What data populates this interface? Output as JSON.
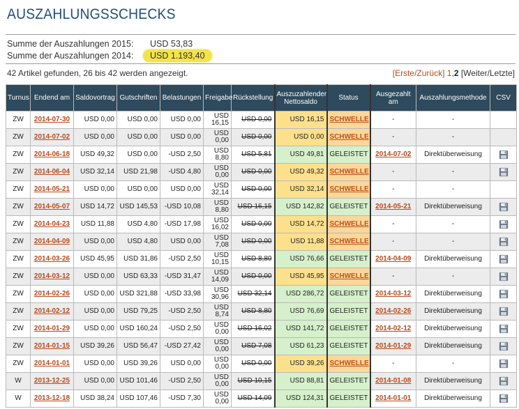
{
  "page": {
    "title": "AUSZAHLUNGSSCHECKS",
    "sums": [
      {
        "label": "Summe der Auszahlungen 2015:",
        "value": "USD 53,83",
        "highlight": false
      },
      {
        "label": "Summe der Auszahlungen 2014:",
        "value": "USD 1.193,40",
        "highlight": true
      }
    ],
    "found_text": "42 Artikel gefunden, 26 bis 42 werden angezeigt.",
    "pager": {
      "first_prev": "[Erste/Zurück]",
      "page1": "1",
      "sep": ",",
      "page2": "2",
      "next_last": "[Weiter/Letzte]"
    }
  },
  "table": {
    "headers": [
      "Turnus",
      "Endend am",
      "Saldovortrag",
      "Gutschriften",
      "Belastungen",
      "Freigabe",
      "Rückstellung",
      "Auszuzahlender Nettosaldo",
      "Status",
      "Ausgezahlt am",
      "Auszahlungsmethode",
      "CSV"
    ],
    "rows": [
      {
        "turnus": "ZW",
        "end": "2014-07-30",
        "saldo": "USD 0,00",
        "gut": "USD 0,00",
        "bel": "USD 0,00",
        "frei": [
          "USD",
          "16,15"
        ],
        "rueck": "USD 0,00",
        "netto": "USD 16,15",
        "status": "SCHWELLE",
        "paid": "-",
        "method": "-",
        "csv": false
      },
      {
        "turnus": "ZW",
        "end": "2014-07-02",
        "saldo": "USD 0,00",
        "gut": "USD 0,00",
        "bel": "USD 0,00",
        "frei": [
          "USD",
          "0,00"
        ],
        "rueck": "USD 0,00",
        "netto": "USD 0,00",
        "status": "SCHWELLE",
        "paid": "-",
        "method": "-",
        "csv": false
      },
      {
        "turnus": "ZW",
        "end": "2014-06-18",
        "saldo": "USD 49,32",
        "gut": "USD 0,00",
        "bel": "-USD 2,50",
        "frei": [
          "USD",
          "8,80"
        ],
        "rueck": "USD 5,81",
        "netto": "USD 49,81",
        "status": "GELEISTET",
        "paid": "2014-07-02",
        "method": "Direktüberweisung",
        "csv": true
      },
      {
        "turnus": "ZW",
        "end": "2014-06-04",
        "saldo": "USD 32,14",
        "gut": "USD 21,98",
        "bel": "-USD 4,80",
        "frei": [
          "USD",
          "0,00"
        ],
        "rueck": "USD 0,00",
        "netto": "USD 49,32",
        "status": "SCHWELLE",
        "paid": "-",
        "method": "-",
        "csv": true
      },
      {
        "turnus": "ZW",
        "end": "2014-05-21",
        "saldo": "USD 0,00",
        "gut": "USD 0,00",
        "bel": "USD 0,00",
        "frei": [
          "USD",
          "32,14"
        ],
        "rueck": "USD 0,00",
        "netto": "USD 32,14",
        "status": "SCHWELLE",
        "paid": "-",
        "method": "-",
        "csv": false
      },
      {
        "turnus": "ZW",
        "end": "2014-05-07",
        "saldo": "USD 14,72",
        "gut": "USD 145,53",
        "bel": "-USD 10,08",
        "frei": [
          "USD",
          "8,80"
        ],
        "rueck": "USD 16,15",
        "netto": "USD 142,82",
        "status": "GELEISTET",
        "paid": "2014-05-21",
        "method": "Direktüberweisung",
        "csv": true
      },
      {
        "turnus": "ZW",
        "end": "2014-04-23",
        "saldo": "USD 11,88",
        "gut": "USD 4,80",
        "bel": "-USD 17,98",
        "frei": [
          "USD",
          "16,02"
        ],
        "rueck": "USD 0,00",
        "netto": "USD 14,72",
        "status": "SCHWELLE",
        "paid": "-",
        "method": "-",
        "csv": true
      },
      {
        "turnus": "ZW",
        "end": "2014-04-09",
        "saldo": "USD 0,00",
        "gut": "USD 4,80",
        "bel": "USD 0,00",
        "frei": [
          "USD",
          "7,08"
        ],
        "rueck": "USD 0,00",
        "netto": "USD 11,88",
        "status": "SCHWELLE",
        "paid": "-",
        "method": "-",
        "csv": true
      },
      {
        "turnus": "ZW",
        "end": "2014-03-26",
        "saldo": "USD 45,95",
        "gut": "USD 31,86",
        "bel": "-USD 2,50",
        "frei": [
          "USD",
          "10,15"
        ],
        "rueck": "USD 8,80",
        "netto": "USD 76,66",
        "status": "GELEISTET",
        "paid": "2014-04-09",
        "method": "Direktüberweisung",
        "csv": true
      },
      {
        "turnus": "ZW",
        "end": "2014-03-12",
        "saldo": "USD 0,00",
        "gut": "USD 63,33",
        "bel": "-USD 31,47",
        "frei": [
          "USD",
          "14,09"
        ],
        "rueck": "USD 0,00",
        "netto": "USD 45,95",
        "status": "SCHWELLE",
        "paid": "-",
        "method": "-",
        "csv": true
      },
      {
        "turnus": "ZW",
        "end": "2014-02-26",
        "saldo": "USD 0,00",
        "gut": "USD 321,88",
        "bel": "-USD 33,98",
        "frei": [
          "USD",
          "30,96"
        ],
        "rueck": "USD 32,14",
        "netto": "USD 286,72",
        "status": "GELEISTET",
        "paid": "2014-03-12",
        "method": "Direktüberweisung",
        "csv": true
      },
      {
        "turnus": "ZW",
        "end": "2014-02-12",
        "saldo": "USD 0,00",
        "gut": "USD 79,25",
        "bel": "-USD 2,50",
        "frei": [
          "USD",
          "8,74"
        ],
        "rueck": "USD 8,80",
        "netto": "USD 76,69",
        "status": "GELEISTET",
        "paid": "2014-02-26",
        "method": "Direktüberweisung",
        "csv": true
      },
      {
        "turnus": "ZW",
        "end": "2014-01-29",
        "saldo": "USD 0,00",
        "gut": "USD 160,24",
        "bel": "-USD 2,50",
        "frei": [
          "USD",
          "0,00"
        ],
        "rueck": "USD 16,02",
        "netto": "USD 141,72",
        "status": "GELEISTET",
        "paid": "2014-02-12",
        "method": "Direktüberweisung",
        "csv": true
      },
      {
        "turnus": "ZW",
        "end": "2014-01-15",
        "saldo": "USD 39,26",
        "gut": "USD 56,47",
        "bel": "-USD 27,42",
        "frei": [
          "USD",
          "0,00"
        ],
        "rueck": "USD 7,08",
        "netto": "USD 61,23",
        "status": "GELEISTET",
        "paid": "2014-01-29",
        "method": "Direktüberweisung",
        "csv": true
      },
      {
        "turnus": "ZW",
        "end": "2014-01-01",
        "saldo": "USD 0,00",
        "gut": "USD 39,26",
        "bel": "USD 0,00",
        "frei": [
          "USD",
          "0,00"
        ],
        "rueck": "USD 0,00",
        "netto": "USD 39,26",
        "status": "SCHWELLE",
        "paid": "-",
        "method": "-",
        "csv": true
      },
      {
        "turnus": "W",
        "end": "2013-12-25",
        "saldo": "USD 0,00",
        "gut": "USD 101,46",
        "bel": "-USD 2,50",
        "frei": [
          "USD",
          "0,00"
        ],
        "rueck": "USD 10,15",
        "netto": "USD 88,81",
        "status": "GELEISTET",
        "paid": "2014-01-08",
        "method": "Direktüberweisung",
        "csv": true
      },
      {
        "turnus": "W",
        "end": "2013-12-18",
        "saldo": "USD 38,24",
        "gut": "USD 107,46",
        "bel": "-USD 7,30",
        "frei": [
          "USD",
          "0,00"
        ],
        "rueck": "USD 14,09",
        "netto": "USD 124,31",
        "status": "GELEISTET",
        "paid": "2014-01-01",
        "method": "Direktüberweisung",
        "csv": true
      }
    ]
  },
  "icons": {
    "csv": "floppy-disk-icon"
  },
  "colors": {
    "title": "#1f4f7a",
    "header_bg": "#2e4a5c",
    "link": "#b84a1e",
    "netto_pending": "#fde08c",
    "paid_green": "#d6f0cb",
    "highlight": "#f3e34a"
  }
}
